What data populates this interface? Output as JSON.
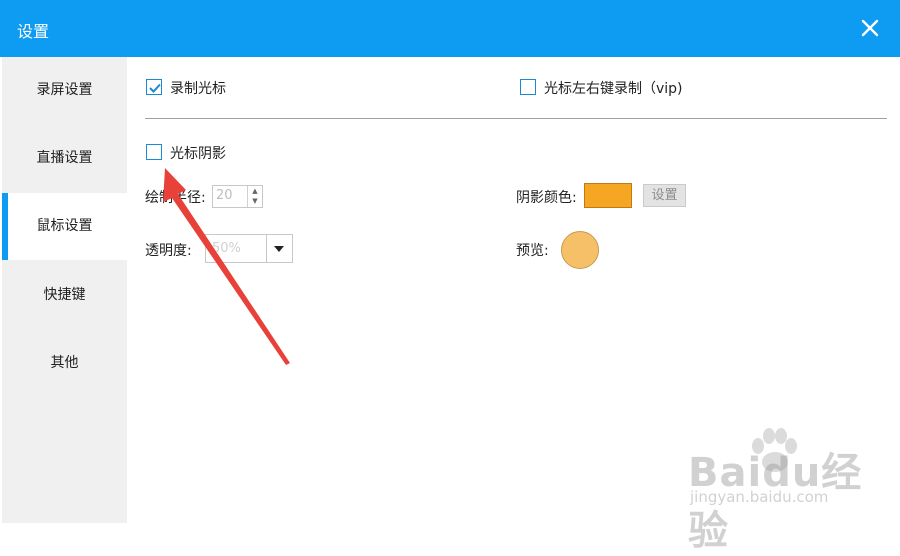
{
  "window": {
    "title": "设置"
  },
  "sidebar": {
    "items": [
      {
        "label": "录屏设置"
      },
      {
        "label": "直播设置"
      },
      {
        "label": "鼠标设置",
        "active": true
      },
      {
        "label": "快捷键"
      },
      {
        "label": "其他"
      }
    ]
  },
  "mouse": {
    "record_cursor": {
      "label": "录制光标",
      "checked": true
    },
    "record_clicks": {
      "label": "光标左右键录制（vip)",
      "checked": false
    },
    "cursor_shadow": {
      "label": "光标阴影",
      "checked": false
    },
    "radius": {
      "label": "绘制半径:",
      "value": "20"
    },
    "opacity": {
      "label": "透明度:",
      "value": "50%"
    },
    "shadow_color": {
      "label": "阴影颜色:",
      "color": "#f5a623",
      "button_label": "设置"
    },
    "preview": {
      "label": "预览:",
      "color": "#f5c067"
    }
  },
  "colors": {
    "accent": "#0d9cf2",
    "annotation_arrow": "#e8413a"
  },
  "watermark": {
    "logo": "Baidu经验",
    "url": "jingyan.baidu.com"
  }
}
